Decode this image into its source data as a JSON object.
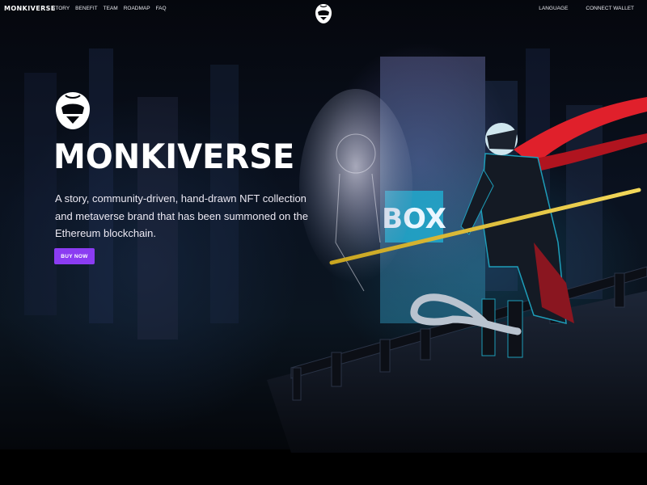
{
  "nav": {
    "brand": "MONKIVERSE",
    "links": [
      "STORY",
      "BENEFIT",
      "TEAM",
      "ROADMAP",
      "FAQ"
    ],
    "language_label": "LANGUAGE",
    "connect_wallet_label": "CONNECT WALLET"
  },
  "hero": {
    "title": "MONKIVERSE",
    "description": "A story, community-driven, hand-drawn NFT collection and metaverse brand that has been summoned on the Ethereum blockchain.",
    "buy_label": "BUY NOW",
    "billboard_text": "BOX"
  },
  "colors": {
    "background": "#05070c",
    "accent_button": "#8b3cf2",
    "scarf": "#e0202b",
    "staff": "#e6c12a",
    "neon": "#24c8e8"
  },
  "icons": {
    "nav_logo": "monkey-head-logo-icon",
    "hero_logo": "monkey-head-logo-icon"
  }
}
